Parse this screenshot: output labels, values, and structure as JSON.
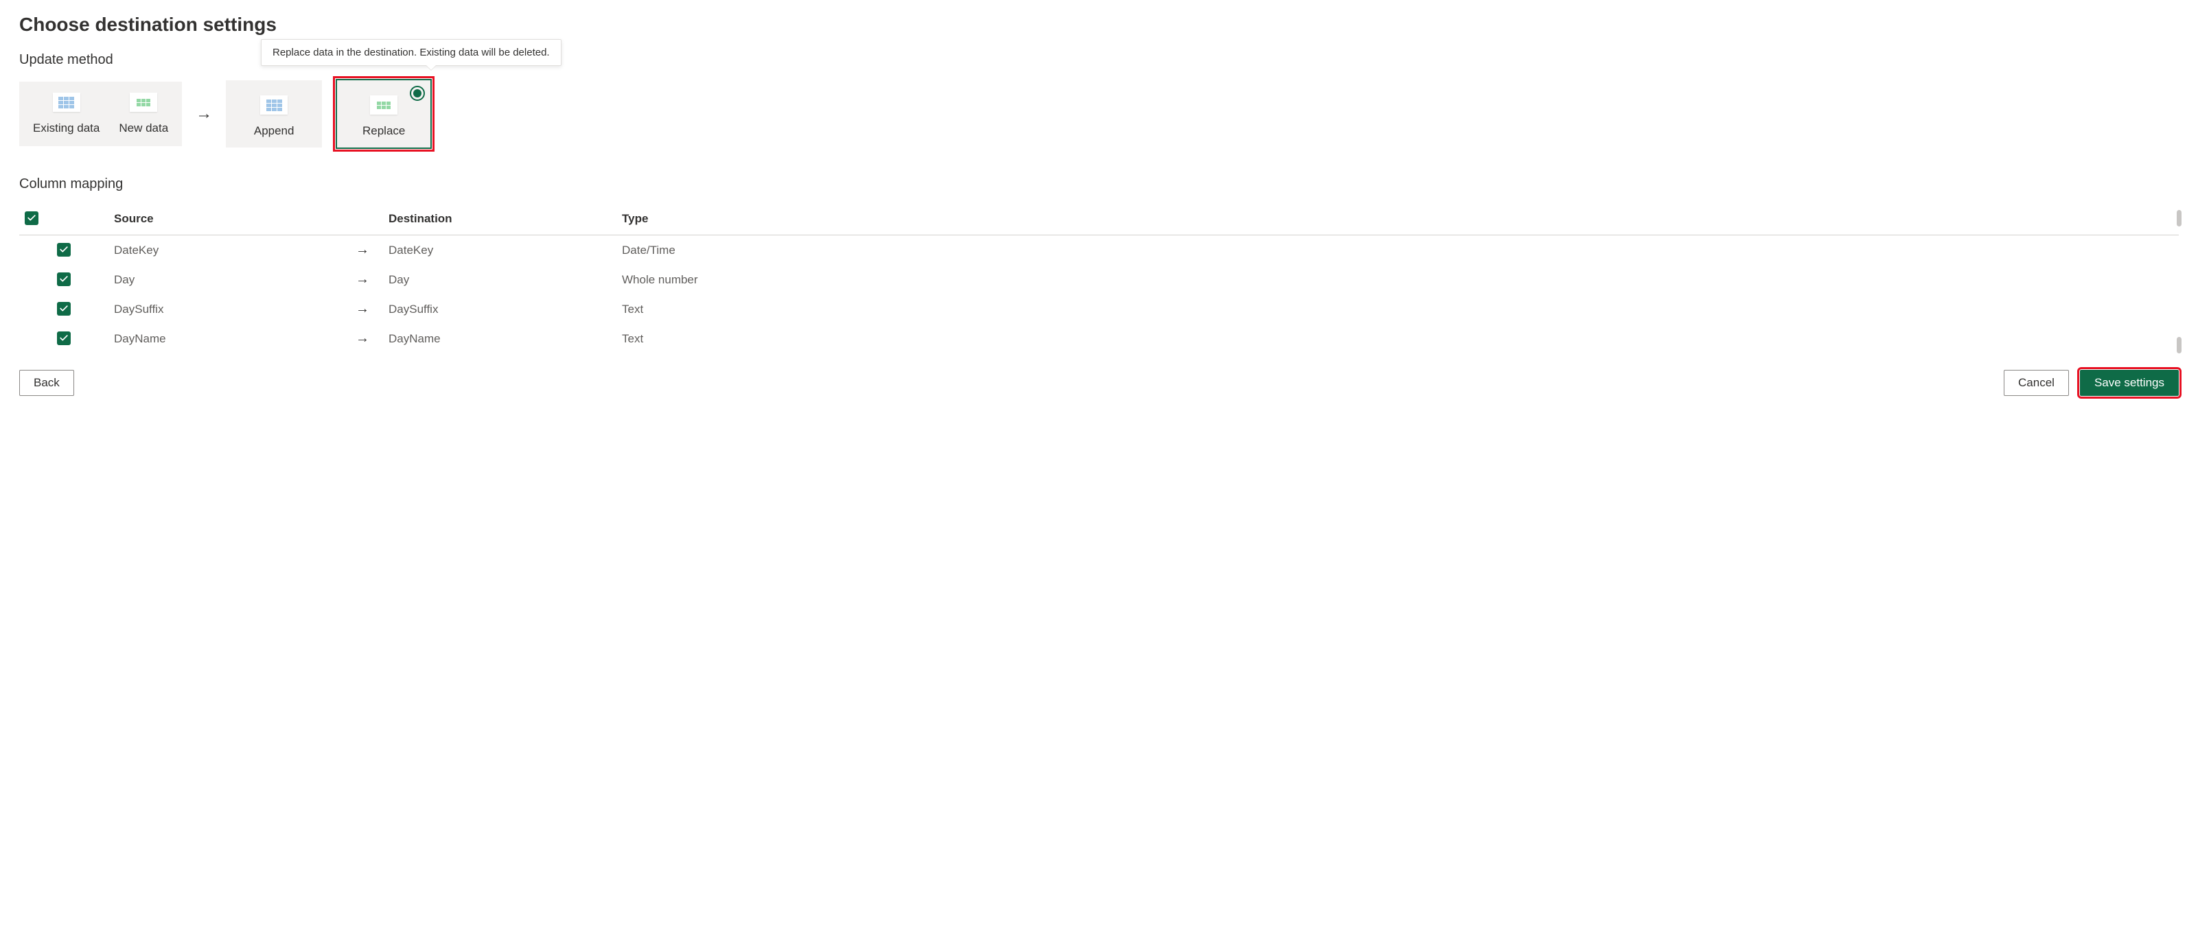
{
  "header": {
    "title": "Choose destination settings"
  },
  "updateMethod": {
    "label": "Update method",
    "tooltip": "Replace data in the destination. Existing data will be deleted.",
    "existingData": "Existing data",
    "newData": "New data",
    "options": {
      "append": "Append",
      "replace": "Replace"
    }
  },
  "columnMapping": {
    "label": "Column mapping",
    "headers": {
      "source": "Source",
      "destination": "Destination",
      "type": "Type"
    },
    "rows": [
      {
        "source": "DateKey",
        "destination": "DateKey",
        "type": "Date/Time"
      },
      {
        "source": "Day",
        "destination": "Day",
        "type": "Whole number"
      },
      {
        "source": "DaySuffix",
        "destination": "DaySuffix",
        "type": "Text"
      },
      {
        "source": "DayName",
        "destination": "DayName",
        "type": "Text"
      }
    ]
  },
  "footer": {
    "back": "Back",
    "cancel": "Cancel",
    "save": "Save settings"
  }
}
